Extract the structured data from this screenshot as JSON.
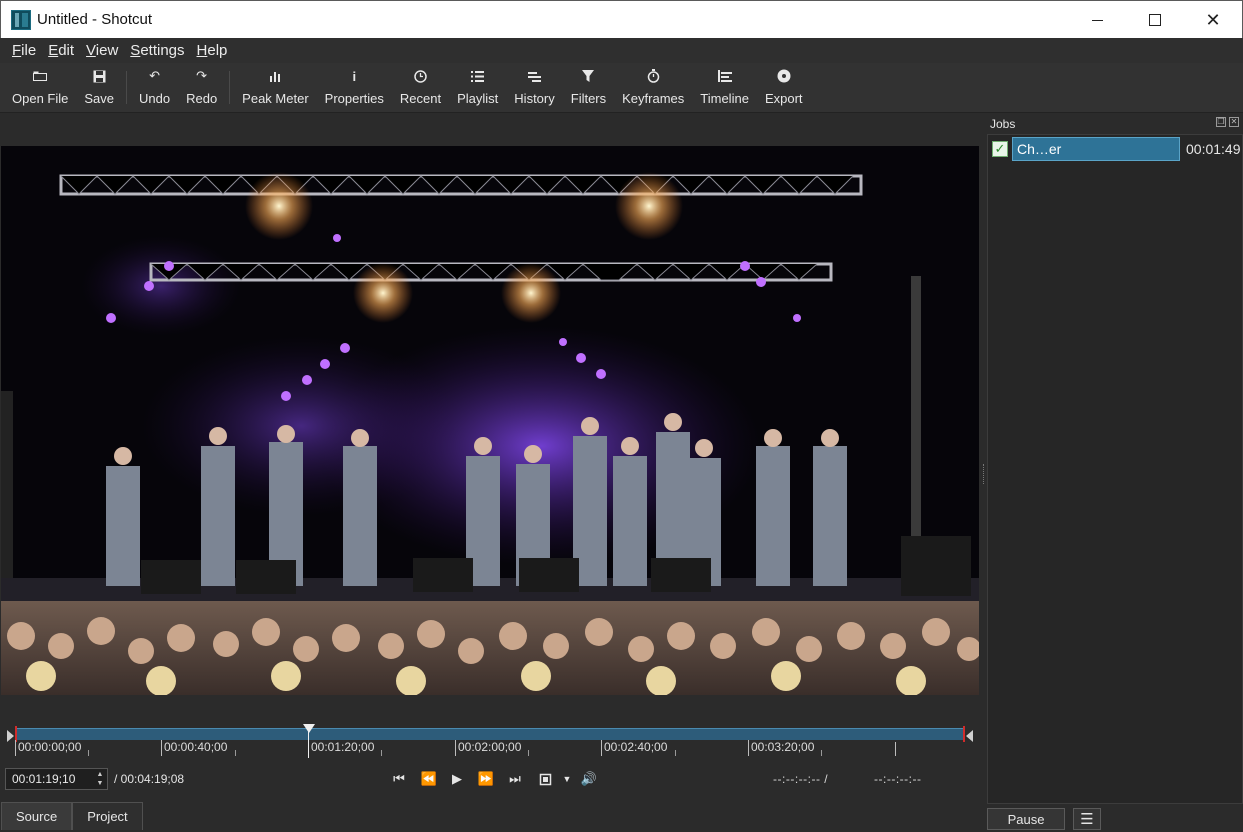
{
  "window": {
    "title": "Untitled - Shotcut",
    "min_glyph": "",
    "max_glyph": "",
    "close_glyph": "✕"
  },
  "menu": [
    {
      "label": "File",
      "underline": "F",
      "rest": "ile"
    },
    {
      "label": "Edit",
      "underline": "E",
      "rest": "dit"
    },
    {
      "label": "View",
      "underline": "V",
      "rest": "iew"
    },
    {
      "label": "Settings",
      "underline": "S",
      "rest": "ettings"
    },
    {
      "label": "Help",
      "underline": "H",
      "rest": "elp"
    }
  ],
  "toolbar": {
    "open_file": "Open File",
    "save": "Save",
    "undo": "Undo",
    "redo": "Redo",
    "peak_meter": "Peak Meter",
    "properties": "Properties",
    "recent": "Recent",
    "playlist": "Playlist",
    "history": "History",
    "filters": "Filters",
    "keyframes": "Keyframes",
    "timeline": "Timeline",
    "export": "Export"
  },
  "player": {
    "ruler_ticks": [
      "00:00:00;00",
      "00:00:40;00",
      "00:01:20;00",
      "00:02:00;00",
      "00:02:40;00",
      "00:03:20;00"
    ],
    "position": "00:01:19;10",
    "duration": "/ 00:04:19;08",
    "in_point": "--:--:--:-- /",
    "out_point": "--:--:--:--",
    "tabs": [
      "Source",
      "Project"
    ]
  },
  "jobs": {
    "title": "Jobs",
    "items": [
      {
        "name": "Ch…er",
        "time": "00:01:49",
        "status": "done"
      }
    ],
    "pause_label": "Pause",
    "menu_glyph": "☰"
  }
}
